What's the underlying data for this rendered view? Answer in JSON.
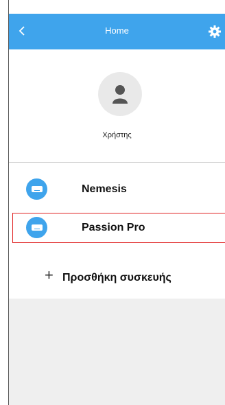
{
  "header": {
    "title": "Home",
    "back_icon": "chevron-left-icon",
    "settings_icon": "gear-icon",
    "color": "#3fa4ec"
  },
  "profile": {
    "avatar_icon": "user-icon",
    "username": "Χρήστης"
  },
  "devices": [
    {
      "name": "Nemesis",
      "icon": "air-conditioner-icon"
    },
    {
      "name": "Passion Pro",
      "icon": "air-conditioner-icon",
      "highlighted": true
    }
  ],
  "add_device": {
    "icon": "plus-icon",
    "label": "Προσθήκη συσκευής"
  },
  "colors": {
    "accent": "#3fa4ec",
    "highlight_border": "#e02020",
    "empty_background": "#efefef"
  }
}
